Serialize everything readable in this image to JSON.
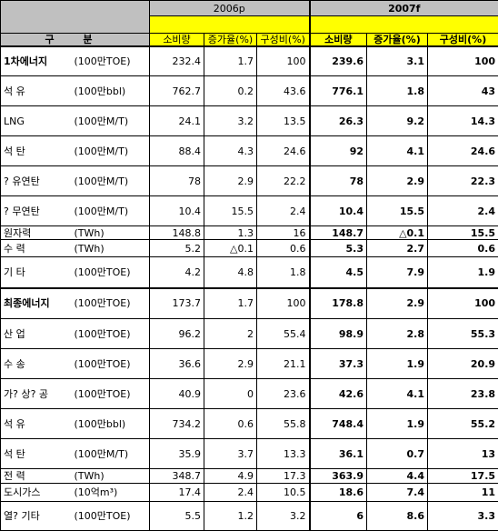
{
  "header": {
    "label": "구 분",
    "year1": "2006p",
    "year2": "2007f",
    "cols_2006": [
      "소비량",
      "증가율(%)",
      "구성비(%)"
    ],
    "cols_2007": [
      "소비량",
      "증가율(%)",
      "구성비(%)"
    ]
  },
  "rows": [
    {
      "name": "1차에너지",
      "unit": "(100만TOE)",
      "v": [
        "232.4",
        "1.7",
        "100",
        "239.6",
        "3.1",
        "100"
      ]
    },
    {
      "name": "석 유",
      "unit": "(100만bbl)",
      "v": [
        "762.7",
        "0.2",
        "43.6",
        "776.1",
        "1.8",
        "43"
      ]
    },
    {
      "name": "LNG",
      "unit": "(100만M/T)",
      "v": [
        "24.1",
        "3.2",
        "13.5",
        "26.3",
        "9.2",
        "14.3"
      ]
    },
    {
      "name": "석 탄",
      "unit": "(100만M/T)",
      "v": [
        "88.4",
        "4.3",
        "24.6",
        "92",
        "4.1",
        "24.6"
      ]
    },
    {
      "name": "? 유연탄",
      "unit": "(100만M/T)",
      "v": [
        "78",
        "2.9",
        "22.2",
        "78",
        "2.9",
        "22.3"
      ]
    },
    {
      "name": "? 무연탄",
      "unit": "(100만M/T)",
      "v": [
        "10.4",
        "15.5",
        "2.4",
        "10.4",
        "15.5",
        "2.4"
      ]
    },
    {
      "name": "원자력",
      "unit": "(TWh)",
      "v": [
        "148.8",
        "1.3",
        "16",
        "148.7",
        "△0.1",
        "15.5"
      ]
    },
    {
      "name": "수 력",
      "unit": "(TWh)",
      "v": [
        "5.2",
        "△0.1",
        "0.6",
        "5.3",
        "2.7",
        "0.6"
      ]
    },
    {
      "name": "기 타",
      "unit": "(100만TOE)",
      "v": [
        "4.2",
        "4.8",
        "1.8",
        "4.5",
        "7.9",
        "1.9"
      ]
    },
    {
      "name": "최종에너지",
      "unit": "(100만TOE)",
      "v": [
        "173.7",
        "1.7",
        "100",
        "178.8",
        "2.9",
        "100"
      ]
    },
    {
      "name": "산 업",
      "unit": "(100만TOE)",
      "v": [
        "96.2",
        "2",
        "55.4",
        "98.9",
        "2.8",
        "55.3"
      ]
    },
    {
      "name": "수 송",
      "unit": "(100만TOE)",
      "v": [
        "36.6",
        "2.9",
        "21.1",
        "37.3",
        "1.9",
        "20.9"
      ]
    },
    {
      "name": "가? 상? 공",
      "unit": "(100만TOE)",
      "v": [
        "40.9",
        "0",
        "23.6",
        "42.6",
        "4.1",
        "23.8"
      ]
    },
    {
      "name": "석 유",
      "unit": "(100만bbl)",
      "v": [
        "734.2",
        "0.6",
        "55.8",
        "748.4",
        "1.9",
        "55.2"
      ]
    },
    {
      "name": "석 탄",
      "unit": "(100만M/T)",
      "v": [
        "35.9",
        "3.7",
        "13.3",
        "36.1",
        "0.7",
        "13"
      ]
    },
    {
      "name": "전 력",
      "unit": "(TWh)",
      "v": [
        "348.7",
        "4.9",
        "17.3",
        "363.9",
        "4.4",
        "17.5"
      ]
    },
    {
      "name": "도시가스",
      "unit": "(10억m³)",
      "v": [
        "17.4",
        "2.4",
        "10.5",
        "18.6",
        "7.4",
        "11"
      ]
    },
    {
      "name": "열? 기타",
      "unit": "(100만TOE)",
      "v": [
        "5.5",
        "1.2",
        "3.2",
        "6",
        "8.6",
        "3.3"
      ]
    }
  ]
}
